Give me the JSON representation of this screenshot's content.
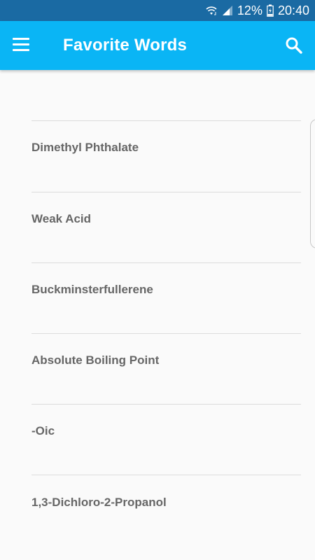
{
  "status_bar": {
    "battery": "12%",
    "time": "20:40",
    "icons": [
      "wifi-icon",
      "signal-icon",
      "battery-charging-icon"
    ]
  },
  "app_bar": {
    "title": "Favorite Words",
    "menu_icon": "hamburger-menu-icon",
    "search_icon": "search-icon",
    "color": "#0ab5f5"
  },
  "words": [
    {
      "label": "Dimethyl Phthalate"
    },
    {
      "label": "Weak Acid"
    },
    {
      "label": "Buckminsterfullerene"
    },
    {
      "label": "Absolute Boiling Point"
    },
    {
      "label": "-Oic"
    },
    {
      "label": "1,3-Dichloro-2-Propanol"
    }
  ]
}
